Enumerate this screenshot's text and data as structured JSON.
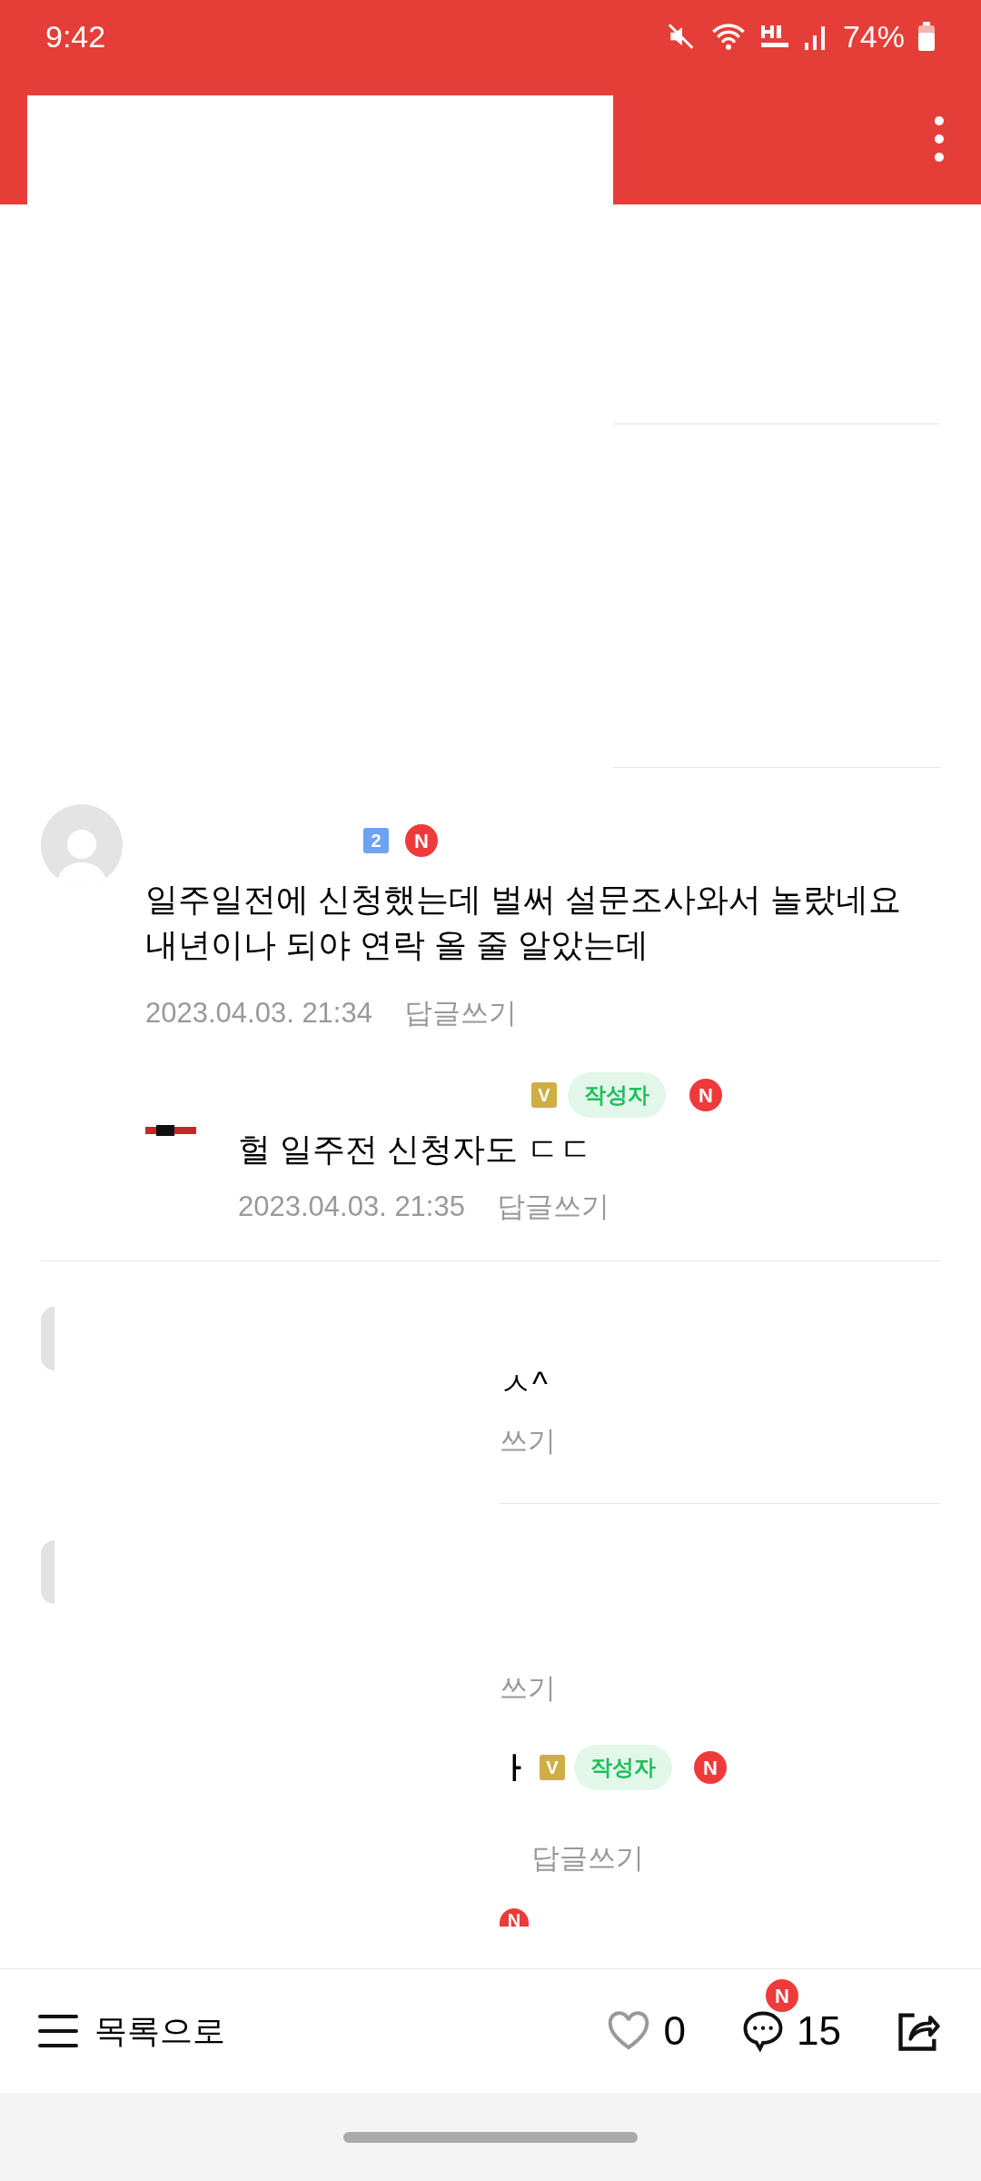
{
  "status_bar": {
    "time": "9:42",
    "battery": "74%"
  },
  "comment": {
    "level_badge": "2",
    "new_badge": "N",
    "lines": [
      "일주일전에 신청했는데 벌써 설문조사와서 놀랐네요",
      "내년이나 되야 연락 올 줄 알았는데"
    ],
    "date": "2023.04.03. 21:34",
    "reply_link": "답글쓰기",
    "reply": {
      "grade_badge": "V",
      "author_badge": "작성자",
      "new_badge": "N",
      "text": "헐 일주전 신청자도 ㄷㄷ",
      "date": "2023.04.03. 21:35",
      "reply_link": "답글쓰기"
    }
  },
  "hidden_comments": [
    {
      "text_fragment": "ㅅ^",
      "reply_fragment": "쓰기"
    },
    {
      "reply_fragment": "쓰기",
      "name_fragment": "ㅏ",
      "grade_badge": "V",
      "author_badge": "작성자",
      "new_badge": "N",
      "reply_link": "답글쓰기",
      "next_badge": "N"
    }
  ],
  "bottom_bar": {
    "list_button": "목록으로",
    "likes": "0",
    "comments": "15",
    "comments_badge": "N"
  }
}
